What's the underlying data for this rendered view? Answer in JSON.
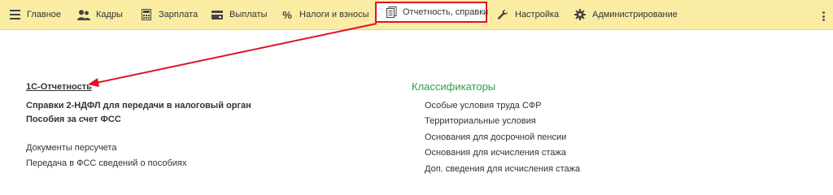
{
  "nav": {
    "items": [
      {
        "label": "Главное",
        "icon": "menu-icon"
      },
      {
        "label": "Кадры",
        "icon": "people-icon"
      },
      {
        "label": "Зарплата",
        "icon": "calculator-icon"
      },
      {
        "label": "Выплаты",
        "icon": "wallet-icon"
      },
      {
        "label": "Налоги и взносы",
        "icon": "percent-icon"
      },
      {
        "label": "Отчетность, справки",
        "icon": "reports-icon",
        "active": true
      },
      {
        "label": "Настройка",
        "icon": "wrench-icon"
      },
      {
        "label": "Администрирование",
        "icon": "gear-icon"
      }
    ],
    "more_icon": "vertical-dots-icon"
  },
  "left_panel": {
    "links": [
      {
        "label": "1С-Отчетность",
        "bold": true,
        "underlined": true
      },
      {
        "label": "Справки 2-НДФЛ для передачи в налоговый орган",
        "bold": true
      },
      {
        "label": "Пособия за счет ФСС",
        "bold": true
      },
      {
        "label": "Документы персучета"
      },
      {
        "label": "Передача в ФСС сведений о пособиях"
      }
    ]
  },
  "right_panel": {
    "title": "Классификаторы",
    "links": [
      {
        "label": "Особые условия труда СФР"
      },
      {
        "label": "Территориальные условия"
      },
      {
        "label": "Основания для досрочной пенсии"
      },
      {
        "label": "Основания для исчисления стажа"
      },
      {
        "label": "Доп. сведения для исчисления стажа"
      }
    ]
  },
  "colors": {
    "navbar_bg": "#fbeca3",
    "highlight_red": "#e0102a",
    "section_green": "#2e9e49",
    "text": "#333333"
  }
}
